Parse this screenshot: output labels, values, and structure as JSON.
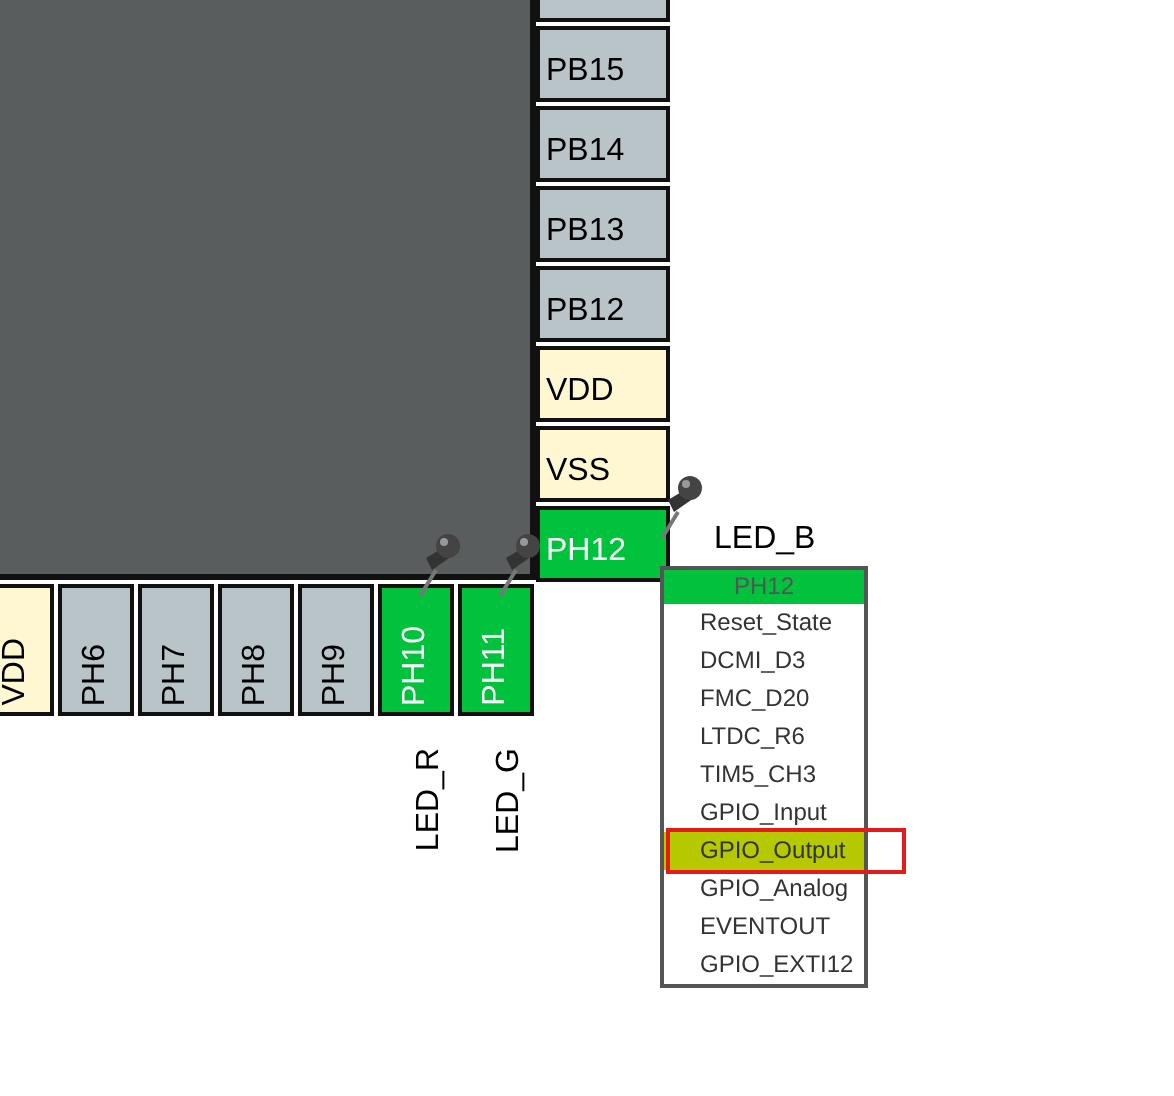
{
  "right_pins": [
    {
      "kind": "signal",
      "configured": false,
      "pinned": false
    },
    {
      "name": "PB15",
      "kind": "signal",
      "configured": false,
      "pinned": false
    },
    {
      "name": "PB14",
      "kind": "signal",
      "configured": false,
      "pinned": false
    },
    {
      "name": "PB13",
      "kind": "signal",
      "configured": false,
      "pinned": false
    },
    {
      "name": "PB12",
      "kind": "signal",
      "configured": false,
      "pinned": false
    },
    {
      "name": "VDD",
      "kind": "power",
      "configured": false,
      "pinned": false
    },
    {
      "name": "VSS",
      "kind": "power",
      "configured": false,
      "pinned": false
    },
    {
      "name": "PH12",
      "kind": "signal",
      "configured": true,
      "pinned": true,
      "label": "LED_B"
    }
  ],
  "bottom_pins": [
    {
      "name": "VDD",
      "kind": "power",
      "configured": false,
      "pinned": false
    },
    {
      "name": "PH6",
      "kind": "signal",
      "configured": false,
      "pinned": false
    },
    {
      "name": "PH7",
      "kind": "signal",
      "configured": false,
      "pinned": false
    },
    {
      "name": "PH8",
      "kind": "signal",
      "configured": false,
      "pinned": false
    },
    {
      "name": "PH9",
      "kind": "signal",
      "configured": false,
      "pinned": false
    },
    {
      "name": "PH10",
      "kind": "signal",
      "configured": true,
      "pinned": true,
      "label": "LED_R"
    },
    {
      "name": "PH11",
      "kind": "signal",
      "configured": true,
      "pinned": true,
      "label": "LED_G"
    }
  ],
  "popup": {
    "title": "PH12",
    "items": [
      {
        "label": "Reset_State",
        "selected": false
      },
      {
        "label": "DCMI_D3",
        "selected": false
      },
      {
        "label": "FMC_D20",
        "selected": false
      },
      {
        "label": "LTDC_R6",
        "selected": false
      },
      {
        "label": "TIM5_CH3",
        "selected": false
      },
      {
        "label": "GPIO_Input",
        "selected": false
      },
      {
        "label": "GPIO_Output",
        "selected": true
      },
      {
        "label": "GPIO_Analog",
        "selected": false
      },
      {
        "label": "EVENTOUT",
        "selected": false
      },
      {
        "label": "GPIO_EXTI12",
        "selected": false
      }
    ]
  }
}
